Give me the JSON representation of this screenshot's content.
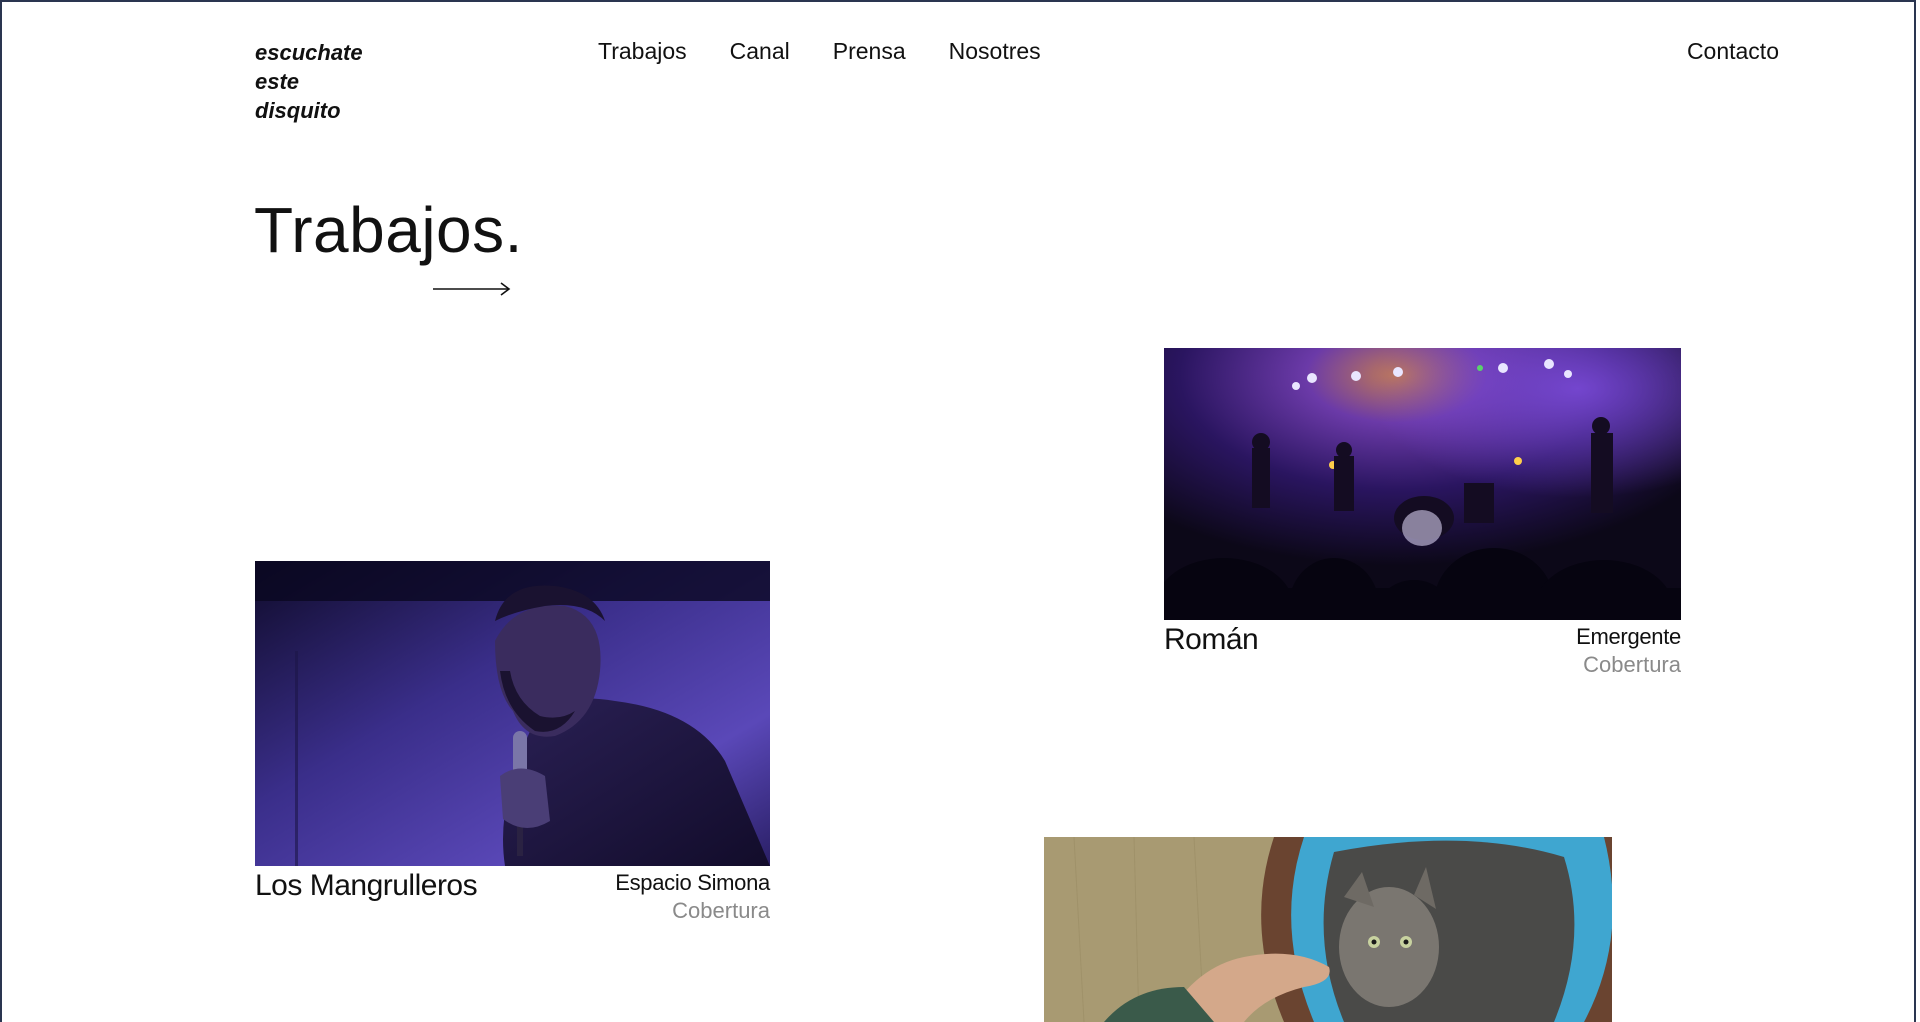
{
  "header": {
    "logo_lines": [
      "escuchate",
      "este",
      "disquito"
    ],
    "nav": [
      "Trabajos",
      "Canal",
      "Prensa",
      "Nosotres"
    ],
    "contact_label": "Contacto"
  },
  "main": {
    "title": "Trabajos.",
    "projects": [
      {
        "name": "Román",
        "venue": "Emergente",
        "category": "Cobertura",
        "image": "concert-stage-photo"
      },
      {
        "name": "Los Mangrulleros",
        "venue": "Espacio Simona",
        "category": "Cobertura",
        "image": "singer-microphone-photo"
      },
      {
        "image": "kitten-in-bed-photo"
      }
    ]
  },
  "colors": {
    "text": "#111111",
    "muted": "#8a8a8a",
    "frame": "#2a3550"
  }
}
